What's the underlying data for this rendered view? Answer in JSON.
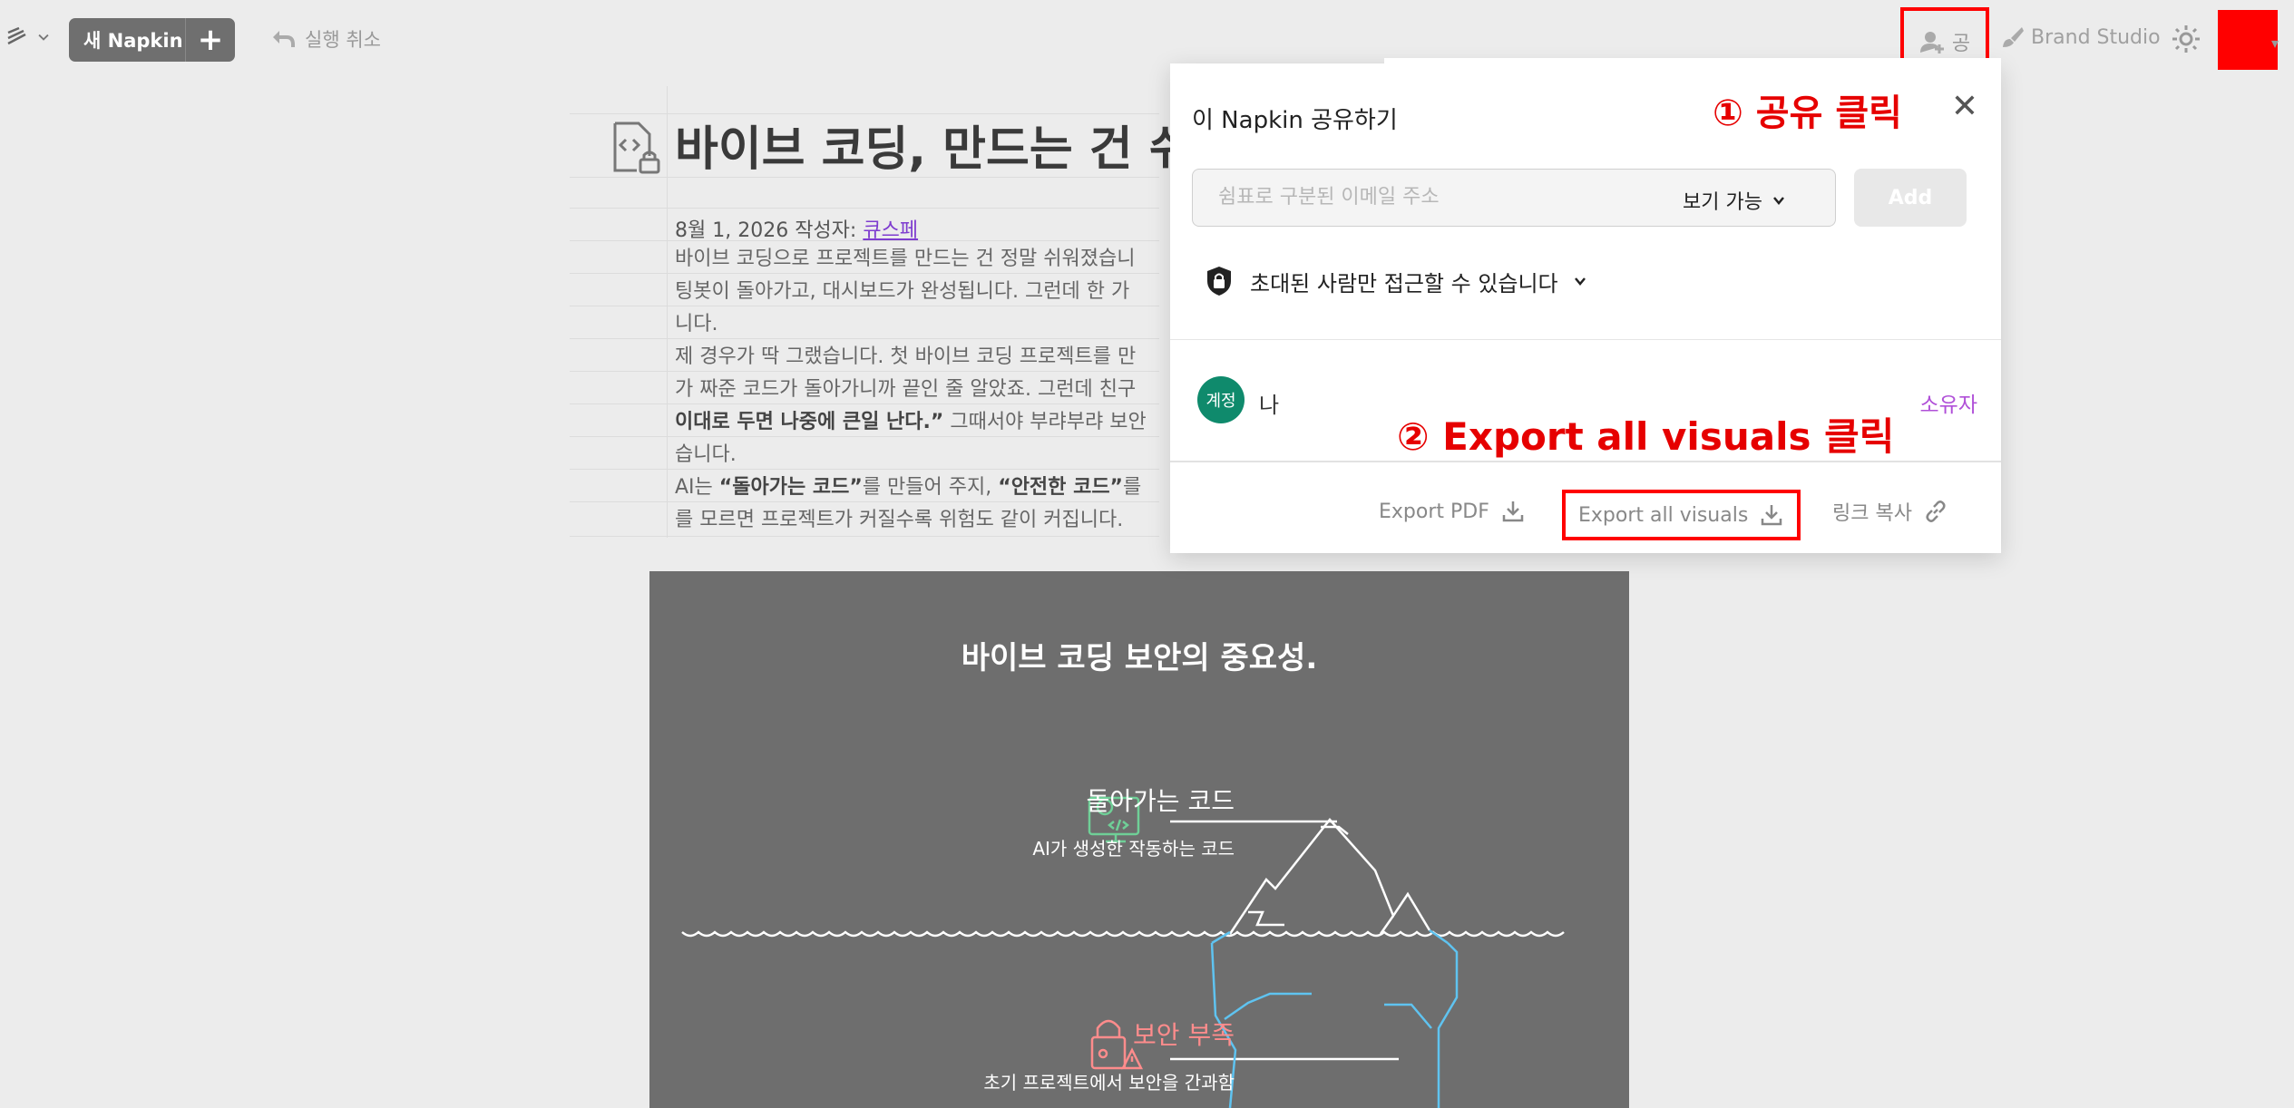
{
  "toolbar": {
    "new_napkin_label": "새 Napkin",
    "new_plus": "+",
    "undo_label": "실행 취소",
    "share_label": "공",
    "brand_studio_label": "Brand Studio"
  },
  "document": {
    "title": "바이브 코딩, 만드는 건 쉬",
    "meta_prefix": "8월 1, 2026 작성자: ",
    "author": "큐스페",
    "lines": [
      {
        "pre": "바이브 코딩으로 프로젝트를 만드는 건 정말 쉬워졌습니",
        "bold": "",
        "post": ""
      },
      {
        "pre": "팅봇이 돌아가고, 대시보드가 완성됩니다. 그런데 한 가",
        "bold": "",
        "post": ""
      },
      {
        "pre": "니다.",
        "bold": "",
        "post": ""
      },
      {
        "pre": "제 경우가 딱 그랬습니다. 첫 바이브 코딩 프로젝트를 만",
        "bold": "",
        "post": ""
      },
      {
        "pre": "가 짜준 코드가 돌아가니까 끝인 줄 알았죠. 그런데 친구",
        "bold": "",
        "post": ""
      },
      {
        "pre": "",
        "bold": "이대로 두면 나중에 큰일 난다.”",
        "post": " 그때서야 부랴부랴 보안"
      },
      {
        "pre": "습니다.",
        "bold": "",
        "post": ""
      },
      {
        "pre": "AI는 ",
        "bold": "“돌아가는 코드”",
        "post": "를 만들어 주지, "
      },
      {
        "pre": "를 모르면 프로젝트가 커질수록 위험도 같이 커집니다.",
        "bold": "",
        "post": ""
      }
    ],
    "line8_bold2": "“안전한 코드”",
    "line8_post2": "를"
  },
  "visual": {
    "title": "바이브 코딩 보안의 중요성.",
    "code_heading": "돌아가는 코드",
    "code_sub": "AI가 생성한 작동하는 코드",
    "security_heading": "보안 부족",
    "security_sub": "초기 프로젝트에서 보안을 간과함"
  },
  "share_panel": {
    "title": "이 Napkin 공유하기",
    "annotation_1": "① 공유 클릭",
    "email_placeholder": "쉼표로 구분된 이메일 주소",
    "permission": "보기 가능",
    "add_label": "Add",
    "access_label": "초대된 사람만 접근할 수 있습니다",
    "member_avatar": "계정",
    "member_name": "나",
    "member_role": "소유자",
    "annotation_2": "② Export all visuals 클릭",
    "export_pdf": "Export PDF",
    "export_visuals": "Export all visuals",
    "copy_link": "링크 복사"
  },
  "colors": {
    "annotation_red": "#e60000",
    "author_link": "#7e3ccf",
    "owner_role": "#b050d8",
    "member_avatar": "#0f8a6c",
    "visual_bg": "#6e6e6e",
    "code_green": "#6fcf97",
    "security_red": "#ff8c8c",
    "iceberg_blue": "#5fc3f0"
  }
}
